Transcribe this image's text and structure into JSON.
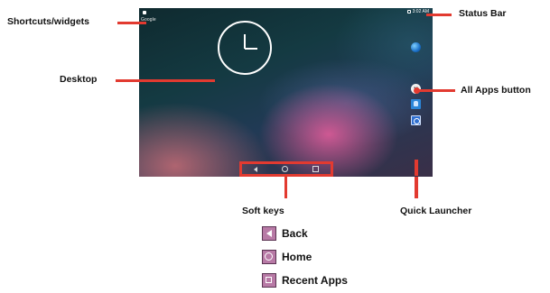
{
  "callouts": {
    "shortcuts": "Shortcuts/widgets",
    "desktop": "Desktop",
    "status_bar": "Status Bar",
    "all_apps": "All Apps button",
    "soft_keys": "Soft keys",
    "quick_launcher": "Quick Launcher"
  },
  "screen": {
    "google_text": "Google",
    "time": "3:02 AM"
  },
  "legend": [
    {
      "label": "Back",
      "icon": "back-triangle-icon"
    },
    {
      "label": "Home",
      "icon": "home-circle-icon"
    },
    {
      "label": "Recent Apps",
      "icon": "recent-square-icon"
    }
  ],
  "colors": {
    "callout_red": "#e23a30",
    "legend_swatch": "#b87aa6"
  }
}
